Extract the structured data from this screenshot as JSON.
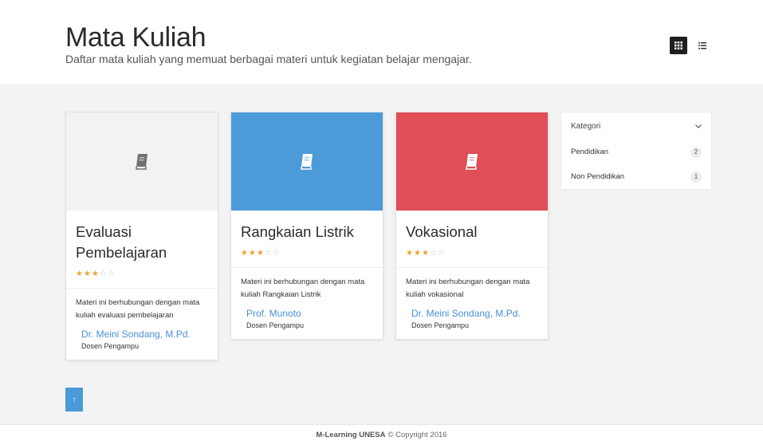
{
  "header": {
    "title": "Mata Kuliah",
    "subtitle": "Daftar mata kuliah yang memuat berbagai materi untuk kegiatan belajar mengajar."
  },
  "view_toggle": {
    "grid_icon": "grid-icon",
    "list_icon": "list-icon"
  },
  "courses": [
    {
      "title": "Evaluasi Pembelajaran",
      "cover_color": "#f2f2f2",
      "icon_color": "#707070",
      "rating": 3,
      "max_rating": 5,
      "description": "Materi ini berhubungan dengan mata kuliah evaluasi pembelajaran",
      "author": "Dr. Meini Sondang, M.Pd.",
      "role": "Dosen Pengampu"
    },
    {
      "title": "Rangkaian Listrik",
      "cover_color": "#4d9ad8",
      "icon_color": "#ffffff",
      "rating": 3,
      "max_rating": 5,
      "description": "Materi ini berhubungan dengan mata kuliah Rangkaian Listrik",
      "author": "Prof. Munoto",
      "role": "Dosen Pengampu"
    },
    {
      "title": "Vokasional",
      "cover_color": "#e04e56",
      "icon_color": "#ffffff",
      "rating": 3,
      "max_rating": 5,
      "description": "Materi ini berhubungan dengan mata kuliah vokasional",
      "author": "Dr. Meini Sondang, M.Pd.",
      "role": "Dosen Pengampu"
    }
  ],
  "category": {
    "label": "Kategori",
    "items": [
      {
        "label": "Pendidikan",
        "count": "2"
      },
      {
        "label": "Non Pendidikan",
        "count": "1"
      }
    ]
  },
  "up_button": {
    "label": "↑"
  },
  "footer": {
    "brand": "M-Learning UNESA",
    "copyright": "© Copyright 2016"
  },
  "colors": {
    "accent": "#4a90d9",
    "star": "#f0a330",
    "background": "#f3f3f3"
  }
}
